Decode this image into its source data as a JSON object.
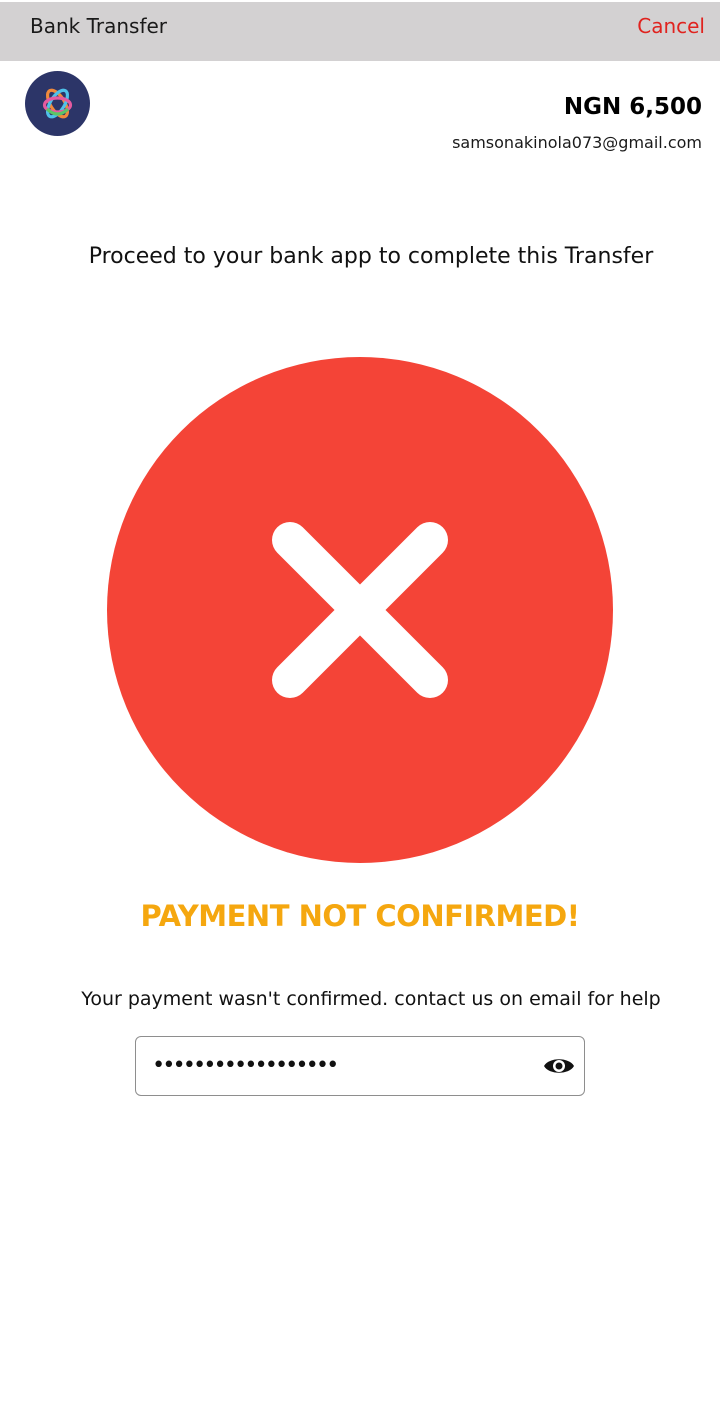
{
  "header": {
    "title": "Bank Transfer",
    "cancel_label": "Cancel"
  },
  "merchant": {
    "logo_icon": "merchant-logo-icon",
    "amount": "NGN 6,500",
    "email": "samsonakinola073@gmail.com"
  },
  "main": {
    "instruction": "Proceed to your bank app to complete this Transfer",
    "status_icon": "error-x-circle-icon",
    "status_title": "PAYMENT NOT CONFIRMED!",
    "status_message": "Your payment wasn't confirmed. contact us on email for help",
    "password_value": "••••••••••••••••••",
    "password_toggle_icon": "eye-icon"
  },
  "colors": {
    "header_bg": "#d3d1d2",
    "cancel": "#e0231f",
    "error_circle": "#f44437",
    "status_title": "#f5a70f",
    "logo_bg": "#2c3568"
  }
}
